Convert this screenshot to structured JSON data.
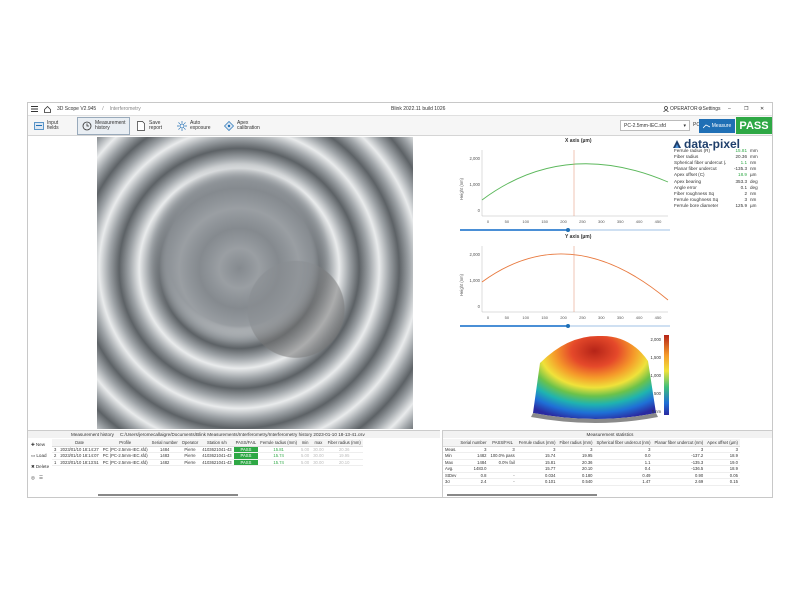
{
  "window": {
    "app_name": "3D Scope V2.945",
    "tab": "Interferometry",
    "build": "Blink 2022.11 build 1026",
    "operator": "OPERATOR",
    "settings": "Settings"
  },
  "toolbar": {
    "input_fields": "Input fields",
    "measurement_history": "Measurement history",
    "save_report": "Save report",
    "auto_exposure": "Auto exposure",
    "apex_calibration": "Apex calibration",
    "profile_value": "PC-2.5mm-IEC.sfd",
    "pc_label": "PC",
    "measure_label": "Measure",
    "pass_label": "PASS"
  },
  "logo_text": "data-pixel",
  "x_chart": {
    "title": "X axis (µm)",
    "ylabel": "Height (nm)",
    "yticks": [
      "2,000",
      "1,000",
      "0"
    ],
    "xticks": [
      "0",
      "50",
      "100",
      "150",
      "200",
      "250",
      "300",
      "350",
      "400",
      "450"
    ]
  },
  "y_chart": {
    "title": "Y axis (µm)",
    "ylabel": "Height (nm)",
    "yticks": [
      "2,000",
      "1,000",
      "0"
    ],
    "xticks": [
      "0",
      "50",
      "100",
      "150",
      "200",
      "250",
      "300",
      "350",
      "400",
      "450"
    ]
  },
  "colorbar": {
    "ticks": [
      "2,000",
      "1,500",
      "1,000",
      "500",
      "0 nm"
    ]
  },
  "measures": [
    {
      "label": "Ferrule radius (R)",
      "value": "15.81",
      "unit": "mm",
      "green": true
    },
    {
      "label": "Fiber radius",
      "value": "20.36",
      "unit": "mm",
      "green": false
    },
    {
      "label": "Spherical fiber undercut (A)",
      "value": "1.1",
      "unit": "nm",
      "green": true
    },
    {
      "label": "Planar fiber undercut",
      "value": "-135.3",
      "unit": "nm",
      "green": false
    },
    {
      "label": "Apex offset (C)",
      "value": "18.9",
      "unit": "µm",
      "green": true
    },
    {
      "label": "Apex bearing",
      "value": "353.3",
      "unit": "deg",
      "green": false
    },
    {
      "label": "Angle error",
      "value": "0.1",
      "unit": "deg",
      "green": false
    },
    {
      "label": "Fiber roughness Sq",
      "value": "2",
      "unit": "nm",
      "green": false
    },
    {
      "label": "Ferrule roughness Sq",
      "value": "3",
      "unit": "nm",
      "green": false
    },
    {
      "label": "Ferrule bore diameter",
      "value": "125.9",
      "unit": "µm",
      "green": false
    }
  ],
  "history": {
    "title": "Measurement history",
    "path": "C:/Users/jeromecallaigre/Documents/Blink Measurements/Interferometry/Interferometry history 2023-01-10 18-13-41.csv",
    "buttons": [
      "New",
      "Load",
      "Delete"
    ],
    "columns": [
      "",
      "Date",
      "Profile",
      "Serial number",
      "Operator",
      "Station s/n",
      "PASS/FAIL",
      "Ferrule radius (mm)",
      "min",
      "max",
      "Fiber radius (mm)"
    ],
    "rows": [
      [
        "3",
        "2023/01/10 18:14:27",
        "PC (PC-2.5mm-IEC.sfd)",
        "1484",
        "Pierre",
        "4103621041-43",
        "PASS",
        "15.81",
        "5.00",
        "30.00",
        "20.36"
      ],
      [
        "2",
        "2023/01/10 18:14:07",
        "PC (PC-2.5mm-IEC.sfd)",
        "1483",
        "Pierre",
        "4103621041-43",
        "PASS",
        "15.74",
        "5.00",
        "30.00",
        "19.95"
      ],
      [
        "1",
        "2023/01/10 18:13:51",
        "PC (PC-2.5mm-IEC.sfd)",
        "1482",
        "Pierre",
        "4103621041-43",
        "PASS",
        "15.74",
        "5.00",
        "30.00",
        "20.10"
      ]
    ]
  },
  "statistics": {
    "title": "Measurement statistics",
    "columns": [
      "",
      "Serial number",
      "PASS/FAIL",
      "Ferrule radius (mm)",
      "Fiber radius (mm)",
      "Spherical fiber undercut (nm)",
      "Planar fiber undercut (nm)",
      "Apex offset (µm)"
    ],
    "rows": [
      [
        "Meas.",
        "3",
        "3",
        "3",
        "3",
        "3",
        "3",
        "3"
      ],
      [
        "Min",
        "1482",
        "100.0% pass",
        "15.74",
        "19.95",
        "0.0",
        "-137.2",
        "18.9"
      ],
      [
        "Max",
        "1484",
        "0.0% fail",
        "15.81",
        "20.36",
        "1.1",
        "-135.3",
        "19.0"
      ],
      [
        "Avg.",
        "1483.0",
        "",
        "15.77",
        "20.10",
        "0.4",
        "-136.5",
        "18.9"
      ],
      [
        "StDev",
        "0.8",
        "-",
        "0.034",
        "0.180",
        "0.49",
        "0.90",
        "0.05"
      ],
      [
        "3σ",
        "2.4",
        "-",
        "0.101",
        "0.540",
        "1.47",
        "2.69",
        "0.15"
      ]
    ]
  }
}
